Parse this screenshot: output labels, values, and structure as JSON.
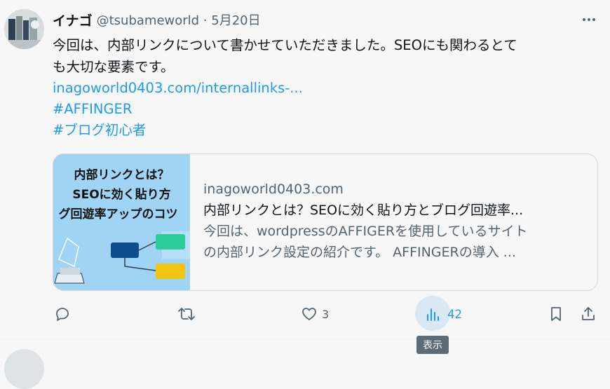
{
  "tweet": {
    "author_name": "イナゴ",
    "handle_and_date": "@tsubameworld · 5月20日",
    "body_line1": "今回は、内部リンクについて書かせていただきました。SEOにも関わるとて",
    "body_line2": "も大切な要素です。",
    "url_link": "inagoworld0403.com/internallinks-...",
    "hashtag1": "#AFFINGER",
    "hashtag2": "#ブログ初心者",
    "card": {
      "domain": "inagoworld0403.com",
      "title": "内部リンクとは？SEOに効く貼り方とブログ回遊率...",
      "desc_line1": "今回は、wordpressのAFFIGERを使用しているサイト",
      "desc_line2": "の内部リンク設定の紹介です。 AFFINGERの導入 ...",
      "image_text_line1": "内部リンクとは？",
      "image_text_line2": "SEOに効く貼り方",
      "image_text_line3": "グ回遊率アップのコツ"
    },
    "actions": {
      "likes": "3",
      "views": "42",
      "views_tooltip": "表示"
    }
  },
  "colors": {
    "accent": "#1d9bf0",
    "muted": "#536471",
    "text": "#0f1419"
  }
}
